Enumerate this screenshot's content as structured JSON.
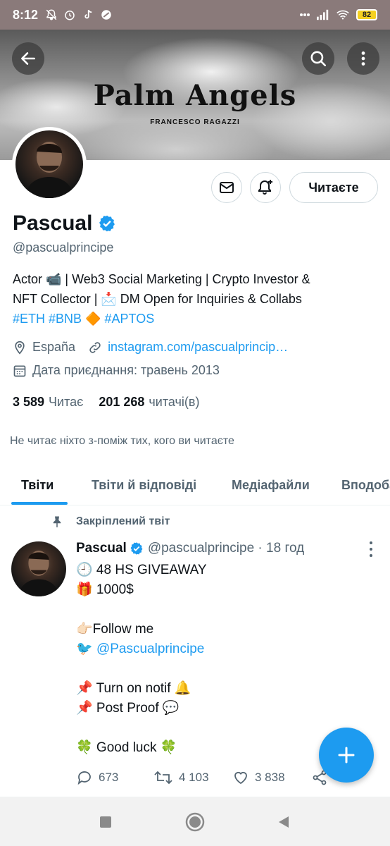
{
  "status_bar": {
    "time": "8:12",
    "battery": "82"
  },
  "banner": {
    "brand": "Palm Angels",
    "brand_sub": "FRANCESCO RAGAZZI"
  },
  "profile": {
    "name": "Pascual",
    "handle": "@pascualprincipe",
    "follow_label": "Читаєте",
    "bio_line1": "Actor 📹 | Web3 Social Marketing  | Crypto Investor &",
    "bio_line2": "NFT Collector | 📩 DM Open  for Inquiries & Collabs",
    "bio_tag1": "#ETH",
    "bio_tag2": "#BNB",
    "bio_tag_sep": "🔶",
    "bio_tag3": "#APTOS",
    "location": "España",
    "link": "instagram.com/pascualprincip…",
    "joined": "Дата приєднання: травень 2013",
    "following_count": "3 589",
    "following_label": "Читає",
    "followers_count": "201 268",
    "followers_label": "читачі(в)",
    "mutuals_text": "Не читає ніхто з-поміж тих, кого ви читаєте"
  },
  "tabs": [
    {
      "label": "Твіти"
    },
    {
      "label": "Твіти й відповіді"
    },
    {
      "label": "Медіафайли"
    },
    {
      "label": "Вподобання"
    }
  ],
  "tweet": {
    "pinned_label": "Закріплений твіт",
    "name": "Pascual",
    "handle_time": "@pascualprincipe · 18 год",
    "lines": [
      "🕘 48 HS GIVEAWAY",
      "🎁 1000$",
      "",
      "👉🏻Follow me",
      " 🐦 ",
      "",
      "📌 Turn on notif 🔔",
      "📌 Post Proof 💬",
      "",
      "🍀 Good luck 🍀"
    ],
    "mention": "@Pascualprincipe",
    "replies": "673",
    "retweets": "4 103",
    "likes": "3 838"
  },
  "colors": {
    "accent": "#1d9bf0",
    "status_bar": "#8a7a7a",
    "text_secondary": "#536471"
  }
}
